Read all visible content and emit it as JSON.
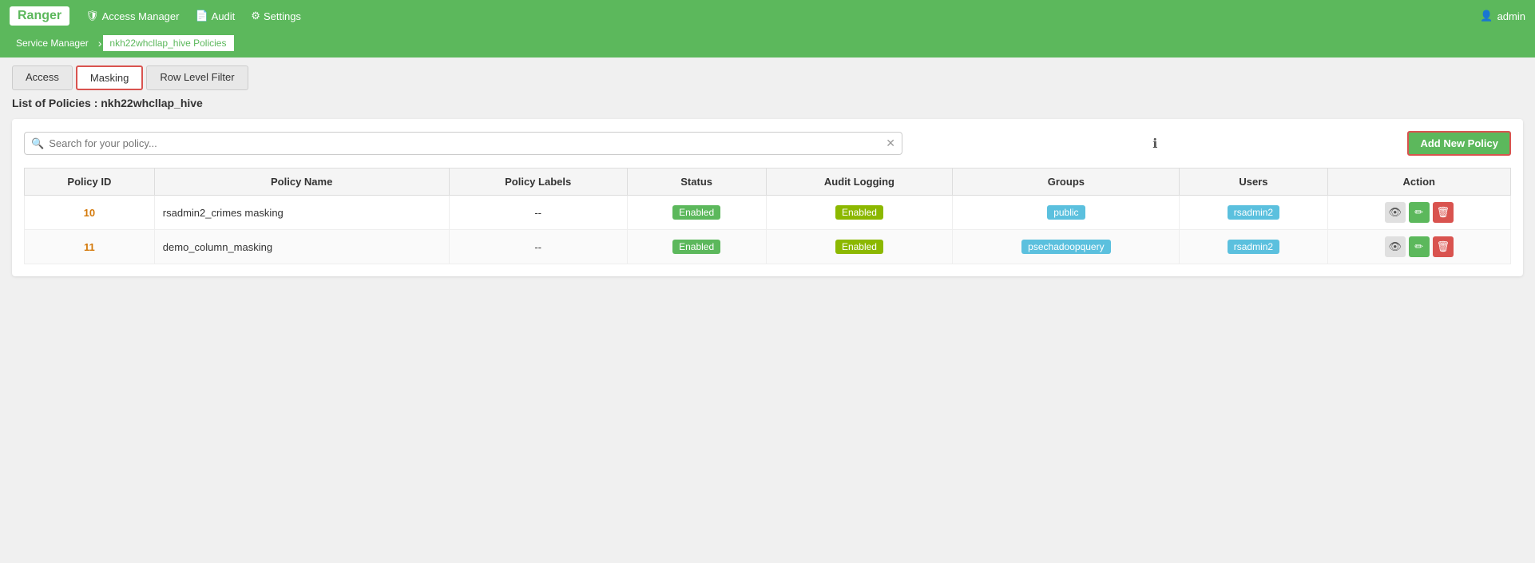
{
  "app": {
    "brand": "Ranger",
    "navbar_items": [
      {
        "label": "Access Manager",
        "icon": "shield"
      },
      {
        "label": "Audit",
        "icon": "file"
      },
      {
        "label": "Settings",
        "icon": "gear"
      }
    ],
    "user": "admin"
  },
  "breadcrumb": {
    "items": [
      {
        "label": "Service Manager",
        "active": false
      },
      {
        "label": "nkh22whcllap_hive Policies",
        "active": true
      }
    ]
  },
  "tabs": [
    {
      "label": "Access",
      "active": false
    },
    {
      "label": "Masking",
      "active": true
    },
    {
      "label": "Row Level Filter",
      "active": false
    }
  ],
  "policy_list_title": "List of Policies : nkh22whcllap_hive",
  "search": {
    "placeholder": "Search for your policy..."
  },
  "add_button_label": "Add New Policy",
  "table": {
    "columns": [
      "Policy ID",
      "Policy Name",
      "Policy Labels",
      "Status",
      "Audit Logging",
      "Groups",
      "Users",
      "Action"
    ],
    "rows": [
      {
        "id": "10",
        "name": "rsadmin2_crimes masking",
        "labels": "--",
        "status": "Enabled",
        "audit_logging": "Enabled",
        "groups": "public",
        "users": "rsadmin2"
      },
      {
        "id": "11",
        "name": "demo_column_masking",
        "labels": "--",
        "status": "Enabled",
        "audit_logging": "Enabled",
        "groups": "psechadoopquery",
        "users": "rsadmin2"
      }
    ]
  }
}
